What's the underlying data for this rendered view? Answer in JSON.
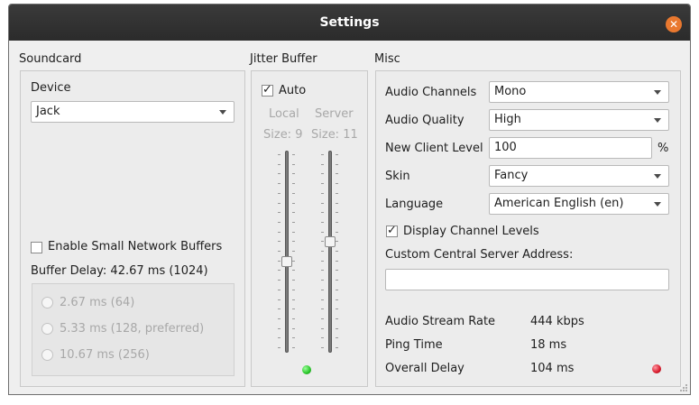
{
  "window": {
    "title": "Settings"
  },
  "soundcard": {
    "group_label": "Soundcard",
    "device_label": "Device",
    "device_value": "Jack",
    "small_buffers_label": "Enable Small Network Buffers",
    "small_buffers_checked": false,
    "buffer_delay_label": "Buffer Delay: 42.67 ms (1024)",
    "buffer_options": [
      {
        "label": "2.67 ms (64)"
      },
      {
        "label": "5.33 ms (128, preferred)"
      },
      {
        "label": "10.67 ms (256)"
      }
    ]
  },
  "jitter": {
    "group_label": "Jitter Buffer",
    "auto_label": "Auto",
    "auto_checked": true,
    "local_label": "Local",
    "server_label": "Server",
    "local_size": "Size: 9",
    "server_size": "Size: 11",
    "local_level_fraction": 0.45,
    "server_level_fraction": 0.55,
    "led_color": "#27c427"
  },
  "misc": {
    "group_label": "Misc",
    "audio_channels_label": "Audio Channels",
    "audio_channels_value": "Mono",
    "audio_quality_label": "Audio Quality",
    "audio_quality_value": "High",
    "new_client_level_label": "New Client Level",
    "new_client_level_value": "100",
    "percent_label": "%",
    "skin_label": "Skin",
    "skin_value": "Fancy",
    "language_label": "Language",
    "language_value": "American English (en)",
    "display_levels_label": "Display Channel Levels",
    "display_levels_checked": true,
    "custom_server_label": "Custom Central Server Address:",
    "custom_server_value": "",
    "stats": [
      {
        "label": "Audio Stream Rate",
        "value": "444 kbps"
      },
      {
        "label": "Ping Time",
        "value": "18 ms"
      },
      {
        "label": "Overall Delay",
        "value": "104 ms"
      }
    ],
    "delay_led_color": "#d8182a"
  }
}
